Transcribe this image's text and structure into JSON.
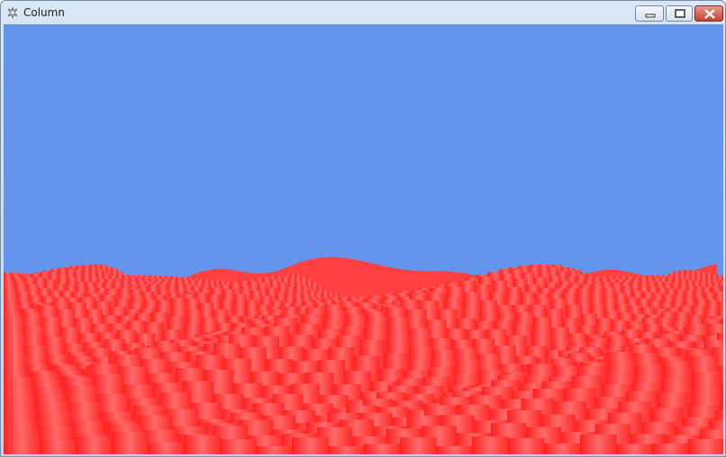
{
  "window": {
    "title": "Column",
    "icons": {
      "app": "application-icon",
      "minimize": "minimize-icon",
      "maximize": "maximize-icon",
      "close": "close-icon"
    }
  },
  "scene": {
    "sky_color": "#6495ed",
    "terrain_color": "#ff3b3b"
  }
}
